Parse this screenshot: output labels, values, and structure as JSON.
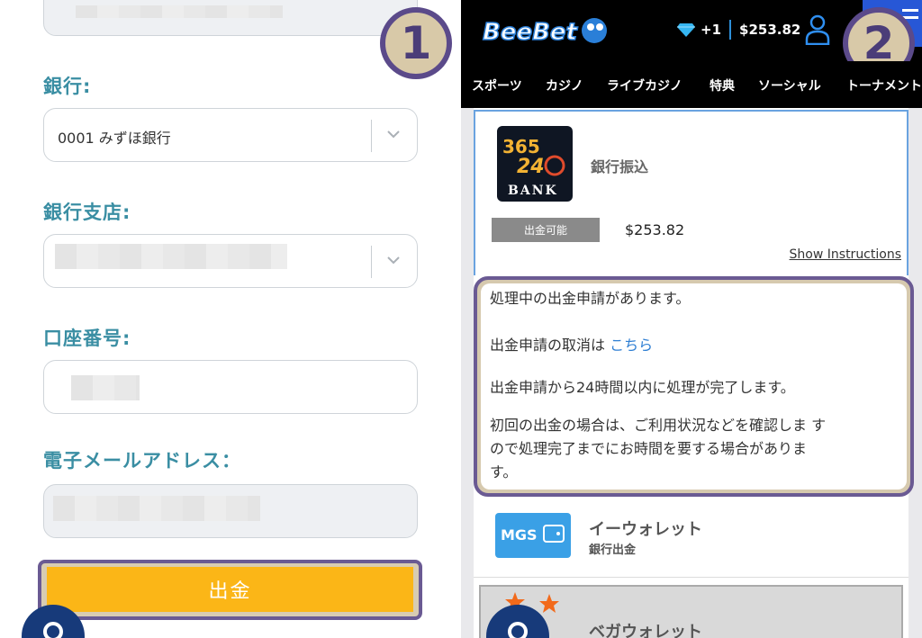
{
  "left_panel": {
    "badge_number": "1",
    "bank_label": "銀行:",
    "bank_value": "0001 みずほ銀行",
    "branch_label": "銀行支店:",
    "account_label": "口座番号:",
    "email_label": "電子メールアドレス：",
    "submit_label": "出金"
  },
  "right_panel": {
    "badge_number": "2",
    "header": {
      "gems": "+1",
      "balance": "$253.82"
    },
    "nav": [
      "スポーツ",
      "カジノ",
      "ライブカジノ",
      "特典",
      "ソーシャル",
      "トーナメント"
    ],
    "bank_method": {
      "name": "銀行振込",
      "status_tag": "出金可能",
      "amount": "$253.82",
      "show_instructions": "Show Instructions"
    },
    "notice": {
      "line1": "処理中の出金申請があります。",
      "line2_prefix": "出金申請の取消は",
      "line2_link": "こちら",
      "line3": "出金申請から24時間以内に処理が完了します。",
      "line4a": "初回の出金の場合は、ご利用状況などを確認しま す",
      "line4b": "ので処理完了までにお時間を要する場合がありま",
      "line4c": "す。"
    },
    "ewallet": {
      "title": "イーウォレット",
      "subtitle": "銀行出金"
    },
    "vega": {
      "title": "ベガウォレット"
    }
  },
  "colors": {
    "label_teal": "#3a8ea3",
    "submit_yellow": "#fbb617",
    "highlight_purple": "#6a5a93",
    "link_blue": "#2f7fd3",
    "menu_blue": "#2757d6"
  }
}
